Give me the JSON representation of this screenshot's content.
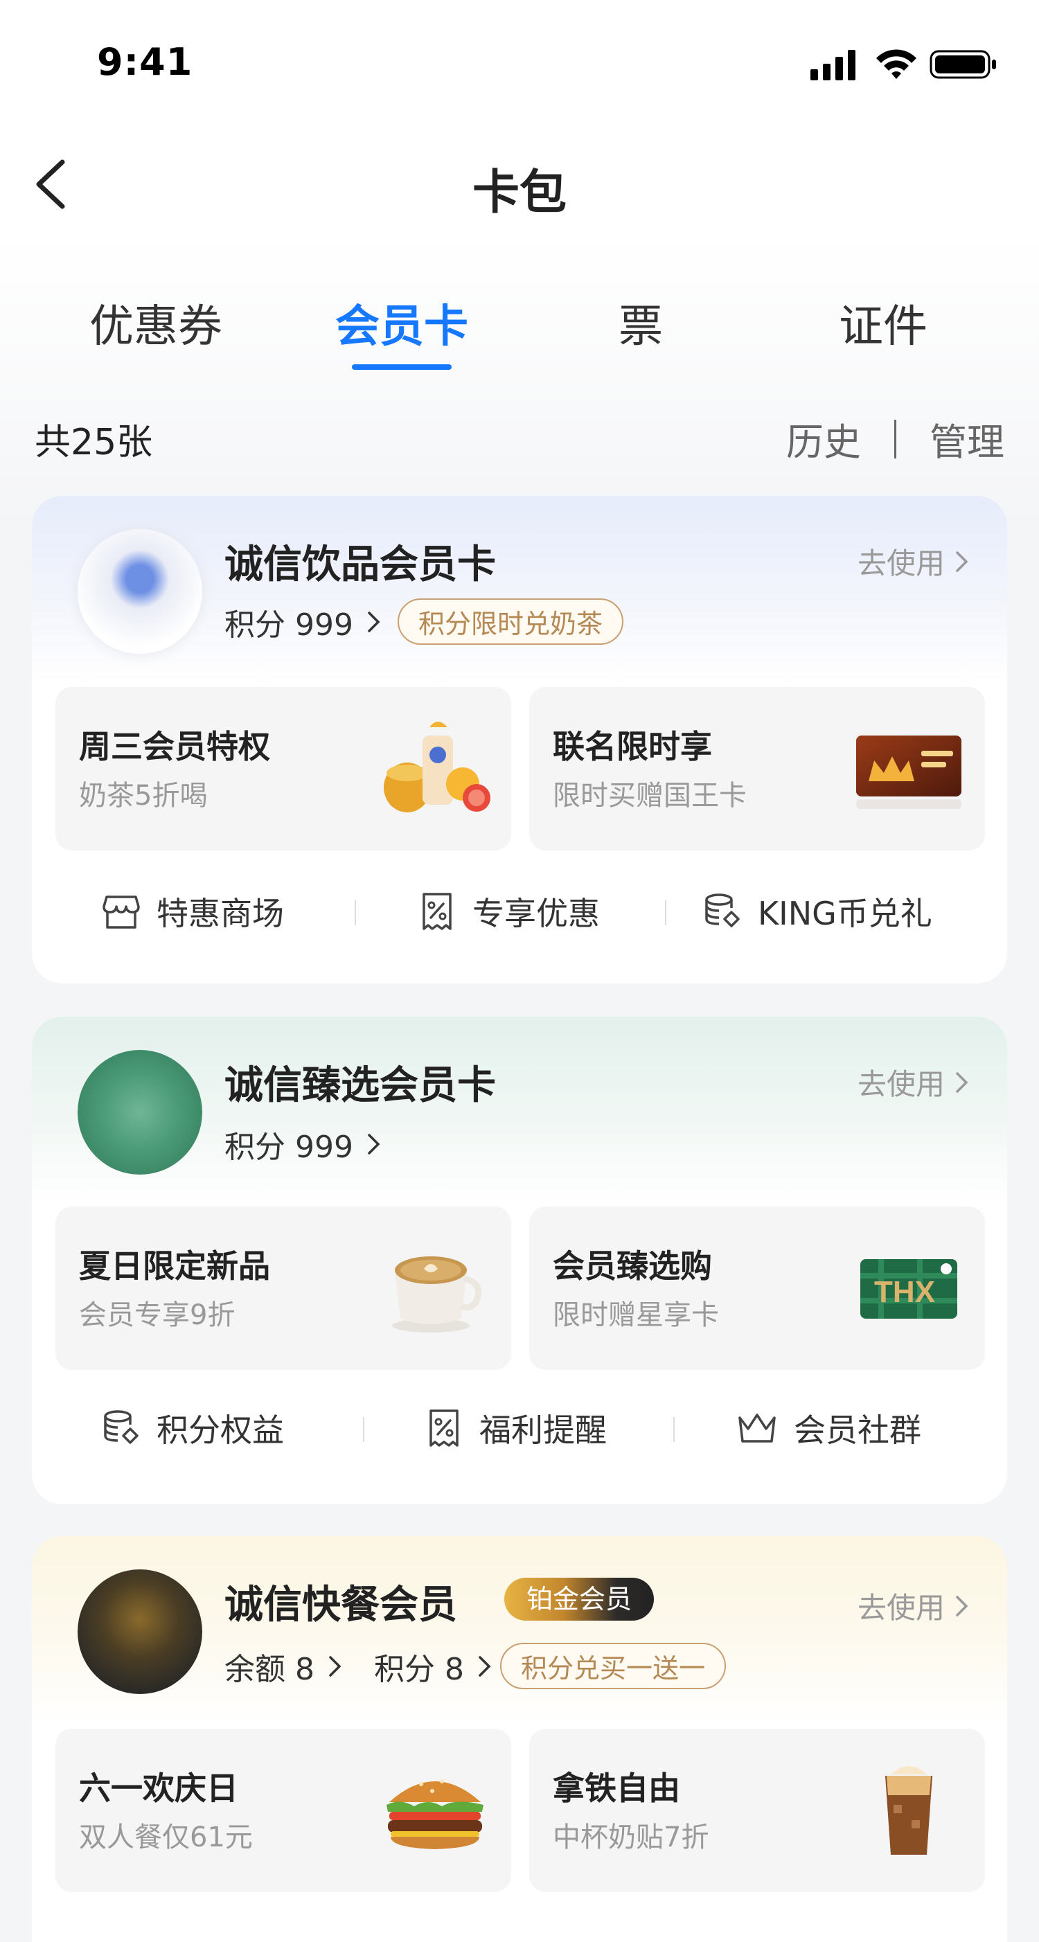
{
  "status_bar": {
    "time": "9:41"
  },
  "nav": {
    "title": "卡包"
  },
  "tabs": [
    {
      "label": "优惠券",
      "active": false
    },
    {
      "label": "会员卡",
      "active": true
    },
    {
      "label": "票",
      "active": false
    },
    {
      "label": "证件",
      "active": false
    }
  ],
  "summary": {
    "count": "共25张",
    "history": "历史",
    "manage": "管理"
  },
  "colors": {
    "accent": "#1677ff",
    "gold": "#b58954"
  },
  "cards": [
    {
      "name": "诚信饮品会员卡",
      "use_label": "去使用",
      "points_label": "积分 999",
      "pill": "积分限时兑奶茶",
      "promos": [
        {
          "title": "周三会员特权",
          "subtitle": "奶茶5折喝",
          "icon": "drinks-fruit-image"
        },
        {
          "title": "联名限时享",
          "subtitle": "限时买赠国王卡",
          "icon": "king-card-image"
        }
      ],
      "actions": [
        {
          "label": "特惠商场",
          "icon": "store-icon"
        },
        {
          "label": "专享优惠",
          "icon": "discount-coupon-icon"
        },
        {
          "label": "KING币兑礼",
          "icon": "coin-stack-icon"
        }
      ]
    },
    {
      "name": "诚信臻选会员卡",
      "use_label": "去使用",
      "points_label": "积分 999",
      "promos": [
        {
          "title": "夏日限定新品",
          "subtitle": "会员专享9折",
          "icon": "latte-cup-image"
        },
        {
          "title": "会员臻选购",
          "subtitle": "限时赠星享卡",
          "icon": "thx-gift-card-image"
        }
      ],
      "actions": [
        {
          "label": "积分权益",
          "icon": "coin-stack-icon"
        },
        {
          "label": "福利提醒",
          "icon": "discount-coupon-icon"
        },
        {
          "label": "会员社群",
          "icon": "crown-icon"
        }
      ]
    },
    {
      "name": "诚信快餐会员",
      "level": "铂金会员",
      "use_label": "去使用",
      "balance_label": "余额 8",
      "points_label": "积分 8",
      "pill": "积分兑买一送一",
      "promos": [
        {
          "title": "六一欢庆日",
          "subtitle": "双人餐仅61元",
          "icon": "burger-image"
        },
        {
          "title": "拿铁自由",
          "subtitle": "中杯奶贴7折",
          "icon": "iced-latte-image"
        }
      ]
    }
  ]
}
